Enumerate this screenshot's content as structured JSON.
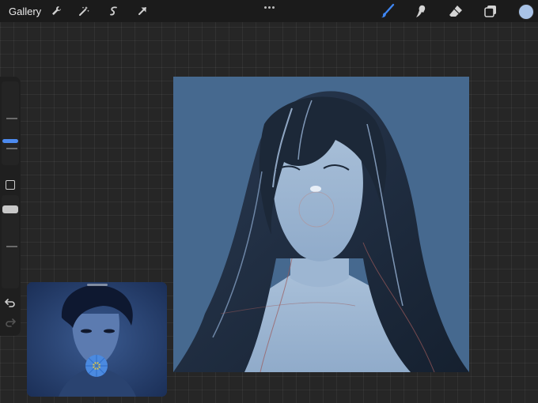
{
  "toolbar": {
    "gallery_label": "Gallery",
    "left_icons": [
      "wrench-icon",
      "magic-wand-icon",
      "selection-icon",
      "transform-arrow-icon"
    ],
    "more_icon": "ellipsis-icon",
    "right_tools": [
      "brush-icon",
      "smudge-icon",
      "eraser-icon",
      "layers-icon"
    ],
    "active_tool": "brush",
    "current_color": "#a9c3e7",
    "accent_color": "#4d8bf0"
  },
  "sidebar": {
    "controls": [
      "brush-size-slider",
      "modify-button",
      "opacity-slider",
      "undo-icon",
      "redo-icon"
    ]
  },
  "canvas": {
    "background_color": "#46698f"
  },
  "reference": {
    "title": ""
  }
}
